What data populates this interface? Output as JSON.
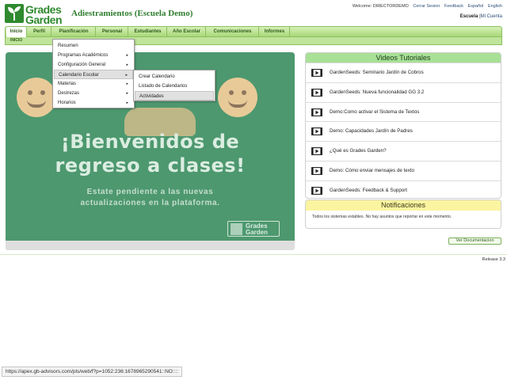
{
  "brand": {
    "name_line1": "Grades",
    "name_line2": "Garden",
    "color": "#2f8a2f"
  },
  "app_title": "Adiestramientos (Escuela Demo)",
  "top_links": {
    "welcome": "Welcome: DIRECTORDEMO",
    "logout": "Cerrar Sesion",
    "feedback": "Feedback",
    "lang_es": "Español",
    "lang_en": "English"
  },
  "school_line": {
    "school": "Escuela",
    "separator": "|",
    "account": "Mi Cuenta"
  },
  "nav": {
    "tabs": [
      {
        "label": "Inicio",
        "active": true
      },
      {
        "label": "Perfil"
      },
      {
        "label": "Planificación"
      },
      {
        "label": "Personal"
      },
      {
        "label": "Estudiantes"
      },
      {
        "label": "Año Escolar"
      },
      {
        "label": "Comunicaciones"
      },
      {
        "label": "Informes"
      }
    ],
    "breadcrumb": "INICIO"
  },
  "planificacion_menu": {
    "items": [
      {
        "label": "Resumen"
      },
      {
        "label": "Programas Académicos",
        "arrow": "▸"
      },
      {
        "label": "Configuración General",
        "arrow": "▸"
      },
      {
        "label": "Calendario Escolar",
        "arrow": "▸"
      },
      {
        "label": "Materias",
        "arrow": "▸"
      },
      {
        "label": "Destrezas",
        "arrow": "▸"
      },
      {
        "label": "Horarios",
        "arrow": "▸"
      }
    ]
  },
  "calendario_submenu": {
    "items": [
      {
        "label": "Crear Calendario"
      },
      {
        "label": "Listado de Calendarios"
      },
      {
        "label": "Actividades"
      }
    ]
  },
  "banner": {
    "line1": "¡Bienvenidos de",
    "line2": "regreso a clases!",
    "sub1": "Estate pendiente a las nuevas",
    "sub2": "actualizaciones en la plataforma.",
    "logo1": "Grades",
    "logo2": "Garden"
  },
  "videos": {
    "title": "Videos Tutoriales",
    "items": [
      "GardenSeeds: Seminario Jardín de Cobros",
      "GardenSeeds: Nueva funcionalidad GG 3.2",
      "Demo:Como activar el Sistema de Textos",
      "Demo: Capacidades Jardín de Padres",
      "¿Qué es Grades Garden?",
      "Demo: Cómo enviar mensajes de texto",
      "GardenSeeds: Feedback & Support"
    ]
  },
  "notifications": {
    "title": "Notificaciones",
    "text": "Todos los sistemas estables. No hay asuntos que reportar en este momento."
  },
  "doc_button": "Ver Documentacion",
  "release": "Release 3.3",
  "status_url": "https://apex.gb-advisors.com/pls/web/f?p=1052:236:1678965290541::NO::::"
}
